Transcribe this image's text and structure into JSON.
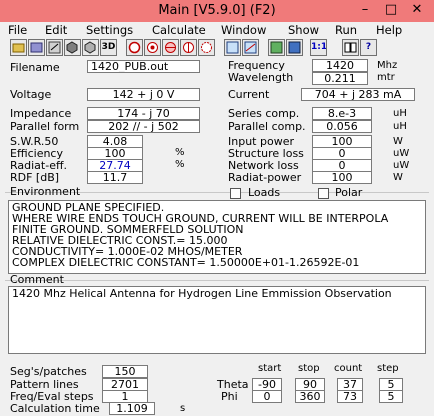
{
  "window": {
    "title": "Main [V5.9.0]  (F2)",
    "min": "–",
    "max": "□",
    "close": "✕"
  },
  "menu": [
    "File",
    "Edit",
    "Settings",
    "Calculate",
    "Window",
    "Show",
    "Run",
    "Help"
  ],
  "toolbar": {
    "btn_3d": "3D",
    "btn_ratio": "1:1"
  },
  "labels": {
    "filename": "Filename",
    "voltage": "Voltage",
    "impedance": "Impedance",
    "parallel_form": "Parallel form",
    "swr": "S.W.R.50",
    "efficiency": "Efficiency",
    "radiat_eff": "Radiat-eff.",
    "rdf": "RDF [dB]",
    "frequency": "Frequency",
    "wavelength": "Wavelength",
    "current": "Current",
    "series_comp": "Series comp.",
    "parallel_comp": "Parallel comp.",
    "input_power": "Input power",
    "structure_loss": "Structure loss",
    "network_loss": "Network loss",
    "radiat_power": "Radiat-power",
    "environment": "Environment",
    "loads": "Loads",
    "polar": "Polar",
    "comment": "Comment",
    "segs": "Seg's/patches",
    "pattern_lines": "Pattern lines",
    "freq_eval": "Freq/Eval steps",
    "calc_time": "Calculation time",
    "start": "start",
    "stop": "stop",
    "count": "count",
    "step": "step",
    "theta": "Theta",
    "phi": "Phi"
  },
  "values": {
    "filename": "1420_PUB.out",
    "voltage": "142 + j 0 V",
    "impedance": "174 - j 70",
    "parallel_form": "202 // - j 502",
    "swr": "4.08",
    "efficiency": "100",
    "radiat_eff": "27.74",
    "rdf": "11.7",
    "frequency": "1420",
    "wavelength": "0.211",
    "current": "704 + j 283 mA",
    "series_comp": "8.e-3",
    "parallel_comp": "0.056",
    "input_power": "100",
    "structure_loss": "0",
    "network_loss": "0",
    "radiat_power": "100",
    "segs": "150",
    "pattern_lines": "2701",
    "freq_eval": "1",
    "calc_time": "1.109",
    "theta_start": "-90",
    "theta_stop": "90",
    "theta_count": "37",
    "theta_step": "5",
    "phi_start": "0",
    "phi_stop": "360",
    "phi_count": "73",
    "phi_step": "5"
  },
  "units": {
    "efficiency": "%",
    "radiat_eff": "%",
    "frequency": "Mhz",
    "wavelength": "mtr",
    "series_comp": "uH",
    "parallel_comp": "uH",
    "input_power": "W",
    "structure_loss": "uW",
    "network_loss": "uW",
    "radiat_power": "W",
    "calc_time": "s"
  },
  "environment_lines": [
    "GROUND PLANE SPECIFIED.",
    "WHERE WIRE ENDS TOUCH GROUND, CURRENT WILL BE INTERPOLA",
    "FINITE GROUND.  SOMMERFELD SOLUTION",
    "RELATIVE DIELECTRIC CONST.= 15.000",
    "CONDUCTIVITY= 1.000E-02 MHOS/METER",
    "COMPLEX DIELECTRIC CONSTANT= 1.50000E+01-1.26592E-01"
  ],
  "comment_text": "1420 Mhz Helical Antenna for Hydrogen Line Emmission Observation",
  "colors": {
    "titlebar": "#f07a7a",
    "highlight_value": "#0000c0"
  }
}
